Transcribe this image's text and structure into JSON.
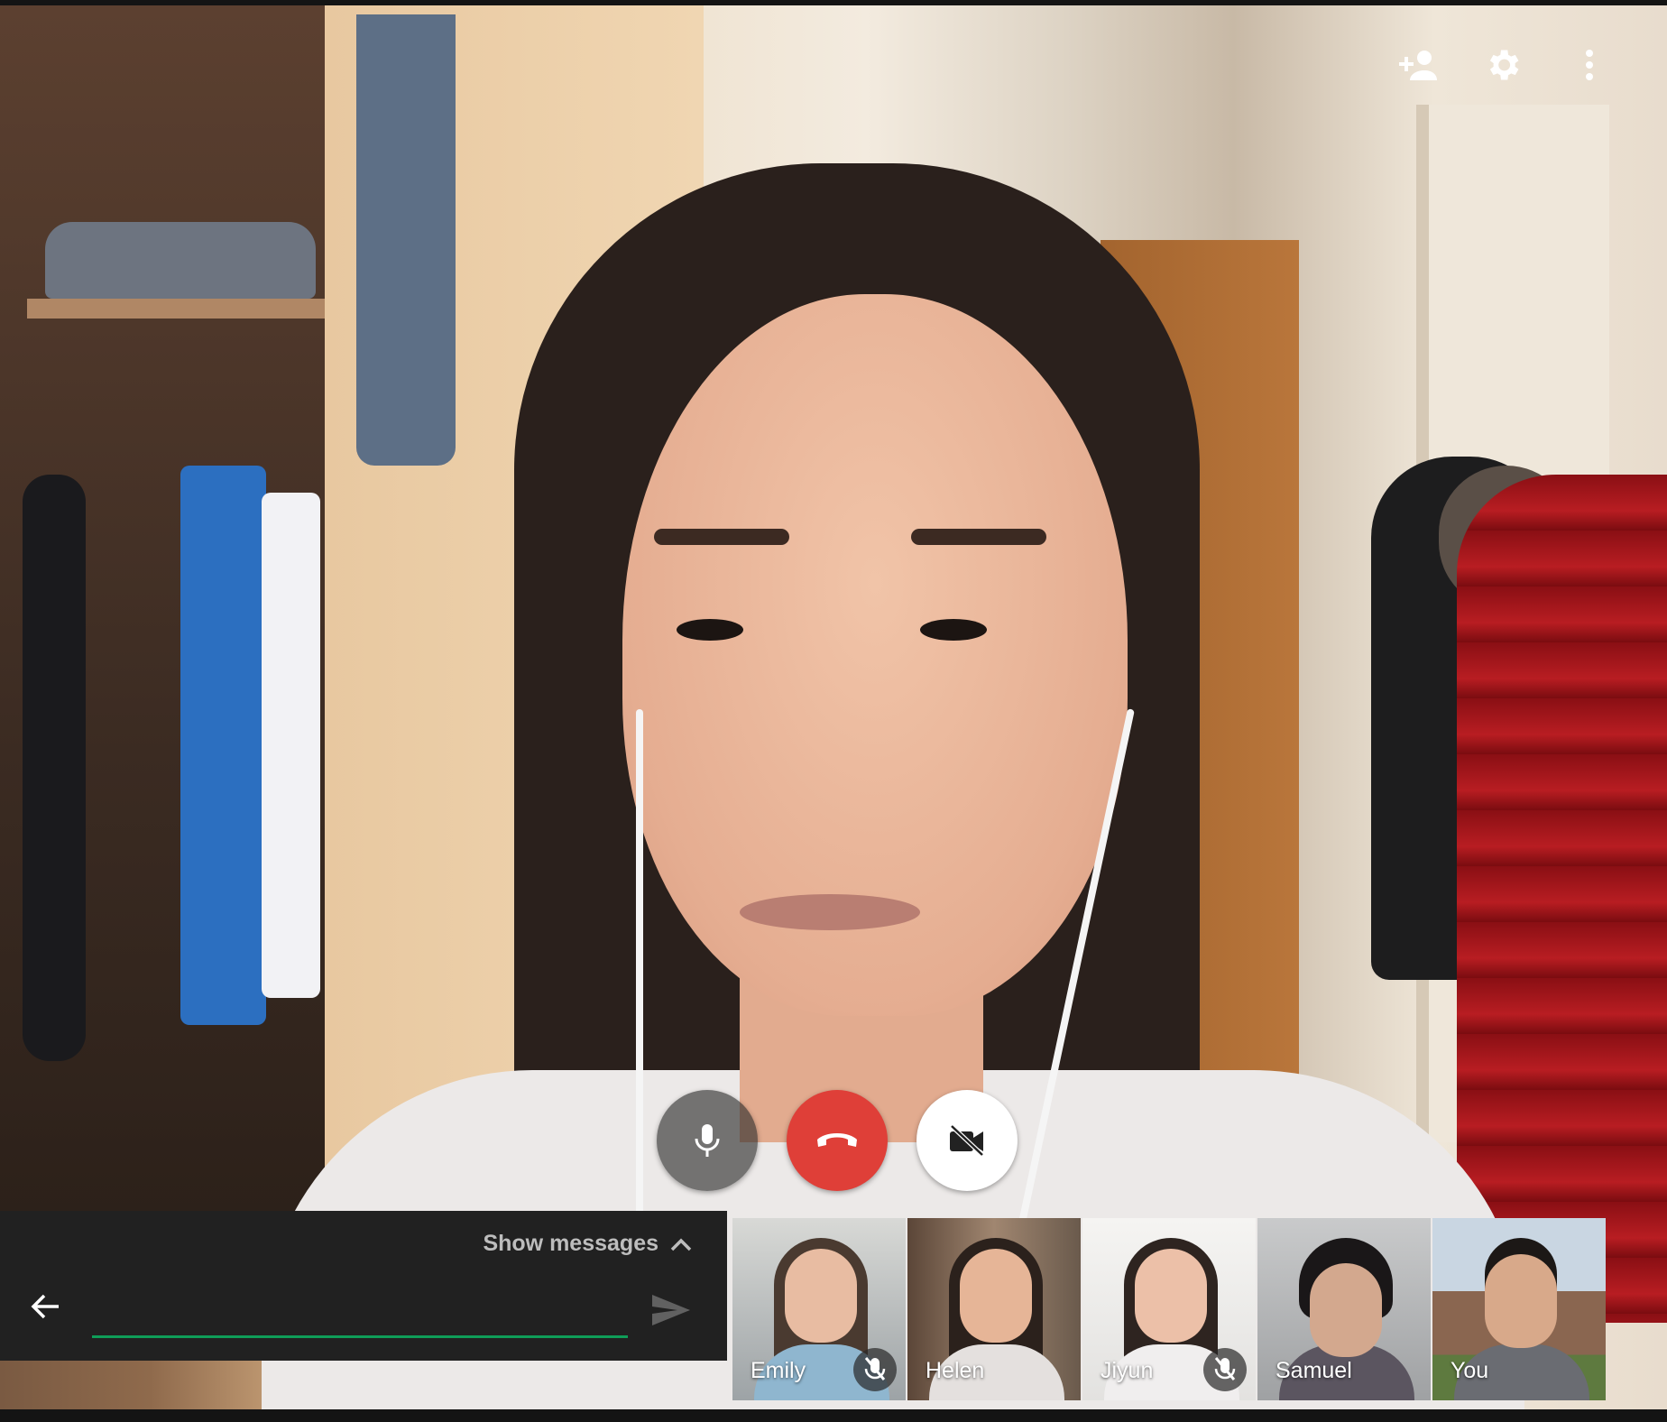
{
  "header": {
    "icons": [
      "add-person-icon",
      "gear-icon",
      "more-vert-icon"
    ]
  },
  "call_controls": {
    "mic_icon": "mic-icon",
    "hangup_icon": "phone-hangup-icon",
    "camera_icon": "videocam-off-icon",
    "colors": {
      "hangup": "#df3f38",
      "camera_off_bg": "#ffffff",
      "mic_bg": "#3a3a3a"
    }
  },
  "chat": {
    "toggle_label": "Show messages",
    "input_value": "",
    "input_placeholder": "",
    "accent": "#0f9d58"
  },
  "participants": [
    {
      "name": "Emily",
      "muted": true,
      "active": false
    },
    {
      "name": "Helen",
      "muted": false,
      "active": true
    },
    {
      "name": "Jiyun",
      "muted": true,
      "active": false
    },
    {
      "name": "Samuel",
      "muted": false,
      "active": false
    },
    {
      "name": "You",
      "muted": false,
      "active": false
    }
  ]
}
